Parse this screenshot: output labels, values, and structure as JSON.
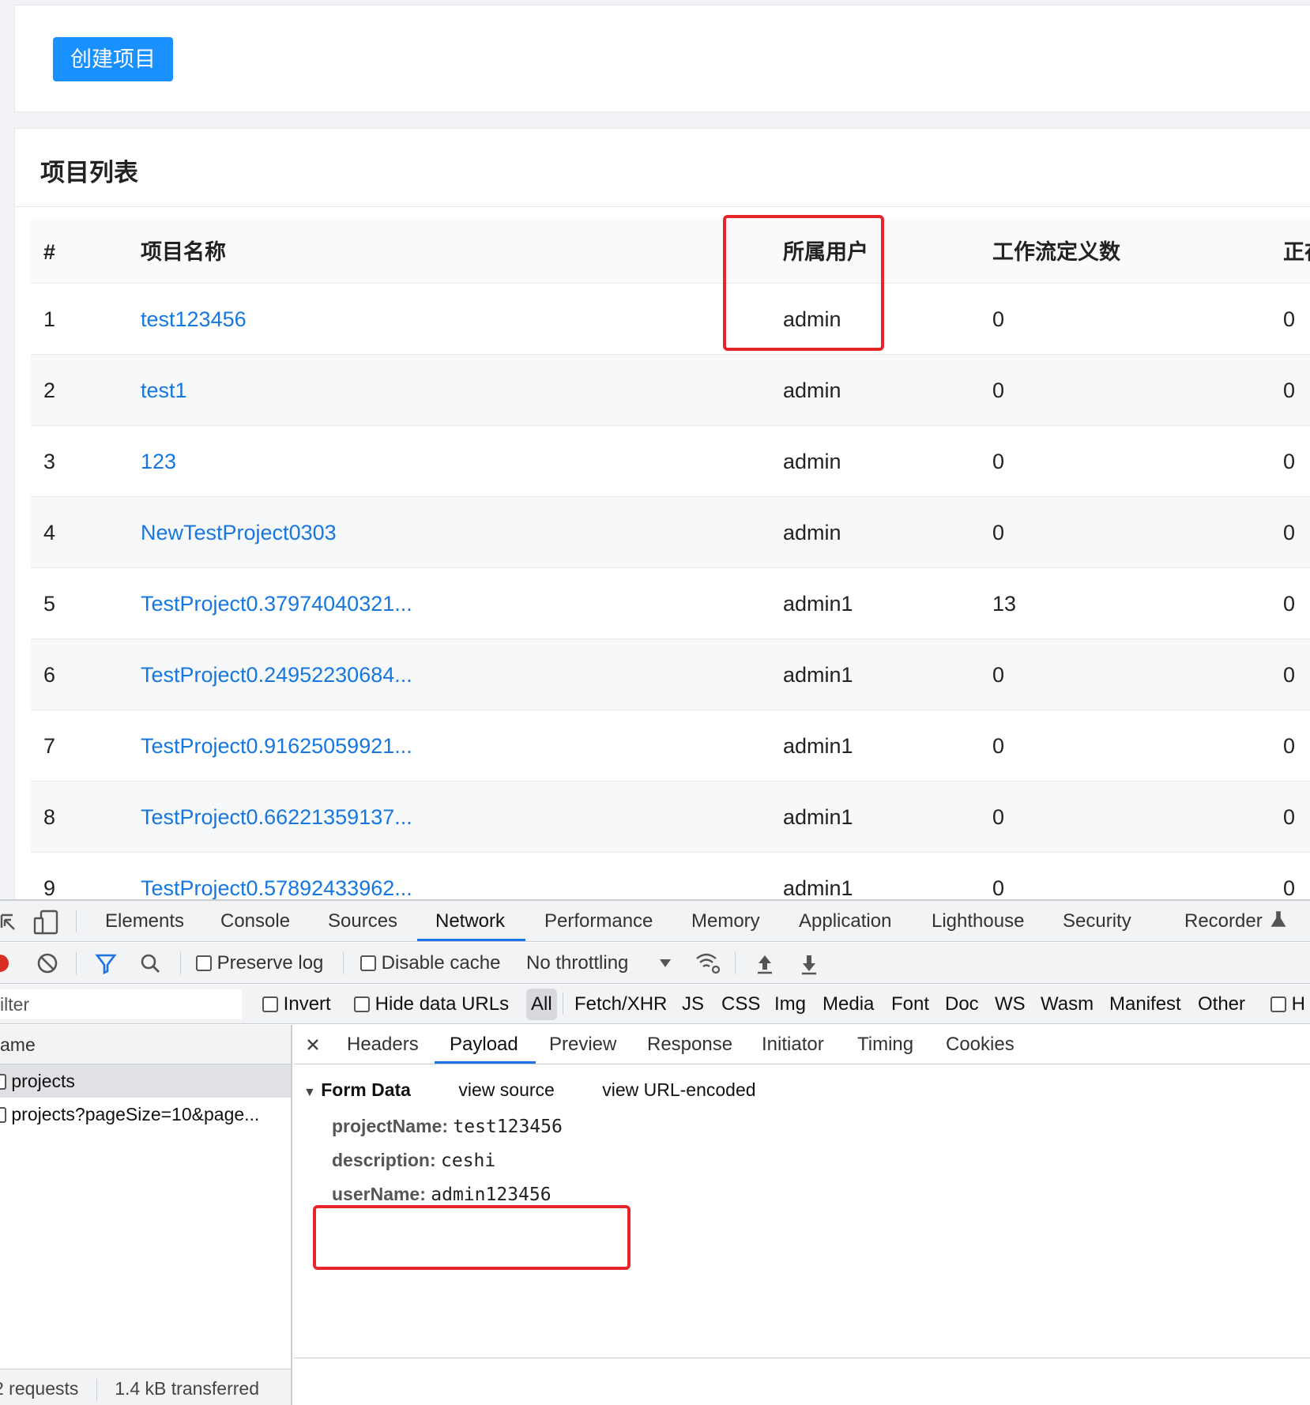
{
  "app": {
    "create_button": "创建项目",
    "list_title": "项目列表",
    "columns": [
      "#",
      "项目名称",
      "所属用户",
      "工作流定义数",
      "正在"
    ],
    "rows": [
      {
        "idx": "1",
        "name": "test123456",
        "user": "admin",
        "wf": "0",
        "running": "0"
      },
      {
        "idx": "2",
        "name": "test1",
        "user": "admin",
        "wf": "0",
        "running": "0"
      },
      {
        "idx": "3",
        "name": "123",
        "user": "admin",
        "wf": "0",
        "running": "0"
      },
      {
        "idx": "4",
        "name": "NewTestProject0303",
        "user": "admin",
        "wf": "0",
        "running": "0"
      },
      {
        "idx": "5",
        "name": "TestProject0.37974040321...",
        "user": "admin1",
        "wf": "13",
        "running": "0"
      },
      {
        "idx": "6",
        "name": "TestProject0.24952230684...",
        "user": "admin1",
        "wf": "0",
        "running": "0"
      },
      {
        "idx": "7",
        "name": "TestProject0.91625059921...",
        "user": "admin1",
        "wf": "0",
        "running": "0"
      },
      {
        "idx": "8",
        "name": "TestProject0.66221359137...",
        "user": "admin1",
        "wf": "0",
        "running": "0"
      },
      {
        "idx": "9",
        "name": "TestProject0.57892433962...",
        "user": "admin1",
        "wf": "0",
        "running": "0"
      }
    ]
  },
  "devtools": {
    "tabs": [
      "Elements",
      "Console",
      "Sources",
      "Network",
      "Performance",
      "Memory",
      "Application",
      "Lighthouse",
      "Security",
      "Recorder"
    ],
    "active_tab": "Network",
    "toolbar": {
      "preserve_log": "Preserve log",
      "disable_cache": "Disable cache",
      "throttling": "No throttling"
    },
    "filter": {
      "placeholder": "ilter",
      "invert": "Invert",
      "hide_data_urls": "Hide data URLs",
      "types": [
        "All",
        "Fetch/XHR",
        "JS",
        "CSS",
        "Img",
        "Media",
        "Font",
        "Doc",
        "WS",
        "Wasm",
        "Manifest",
        "Other"
      ],
      "trailing": "H"
    },
    "request_list": {
      "header": "ame",
      "items": [
        "projects",
        "projects?pageSize=10&page..."
      ],
      "footer_requests": "2 requests",
      "footer_transferred": "1.4 kB transferred"
    },
    "detail_tabs": [
      "Headers",
      "Payload",
      "Preview",
      "Response",
      "Initiator",
      "Timing",
      "Cookies"
    ],
    "active_detail_tab": "Payload",
    "form_data": {
      "title": "Form Data",
      "view_source": "view source",
      "view_url_encoded": "view URL-encoded",
      "fields": [
        {
          "key": "projectName:",
          "value": "test123456"
        },
        {
          "key": "description:",
          "value": "ceshi"
        },
        {
          "key": "userName:",
          "value": "admin123456"
        }
      ]
    }
  },
  "colors": {
    "primary": "#1890ff",
    "link": "#1677e0",
    "highlight_box": "#e5252a",
    "devtools_accent": "#1a73e8"
  }
}
